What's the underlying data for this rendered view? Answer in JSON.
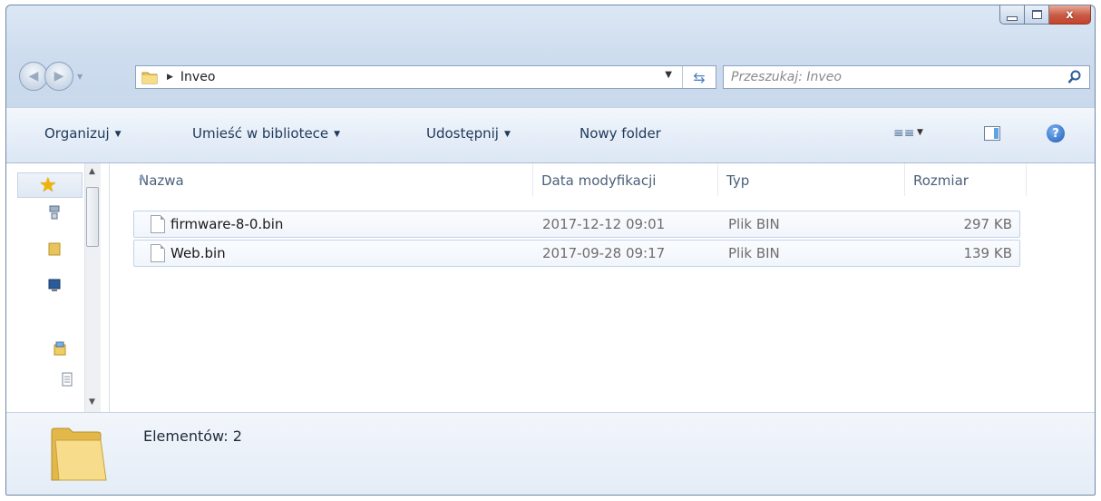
{
  "window": {
    "caption": {
      "minimize": "",
      "maximize": "",
      "close": "x"
    }
  },
  "nav": {
    "path": "Inveo",
    "search_placeholder": "Przeszukaj: Inveo"
  },
  "toolbar": {
    "organize": "Organizuj",
    "include_library": "Umieść w bibliotece",
    "share": "Udostępnij",
    "new_folder": "Nowy folder",
    "help": "?"
  },
  "columns": {
    "name": "Nazwa",
    "date": "Data modyfikacji",
    "type": "Typ",
    "size": "Rozmiar"
  },
  "files": [
    {
      "name": "firmware-8-0.bin",
      "date": "2017-12-12 09:01",
      "type": "Plik BIN",
      "size": "297 KB"
    },
    {
      "name": "Web.bin",
      "date": "2017-09-28 09:17",
      "type": "Plik BIN",
      "size": "139 KB"
    }
  ],
  "details": {
    "count": "Elementów: 2"
  },
  "icons": {
    "back": "back-icon",
    "forward": "forward-icon",
    "folder": "folder-icon",
    "refresh": "refresh-icon",
    "search": "search-icon",
    "favorites": "star-icon",
    "views": "views-icon",
    "preview": "preview-pane-icon",
    "help": "help-icon"
  },
  "colors": {
    "accent": "#1e395b",
    "help_blue": "#1d5ab4",
    "close_red": "#c85a44"
  }
}
